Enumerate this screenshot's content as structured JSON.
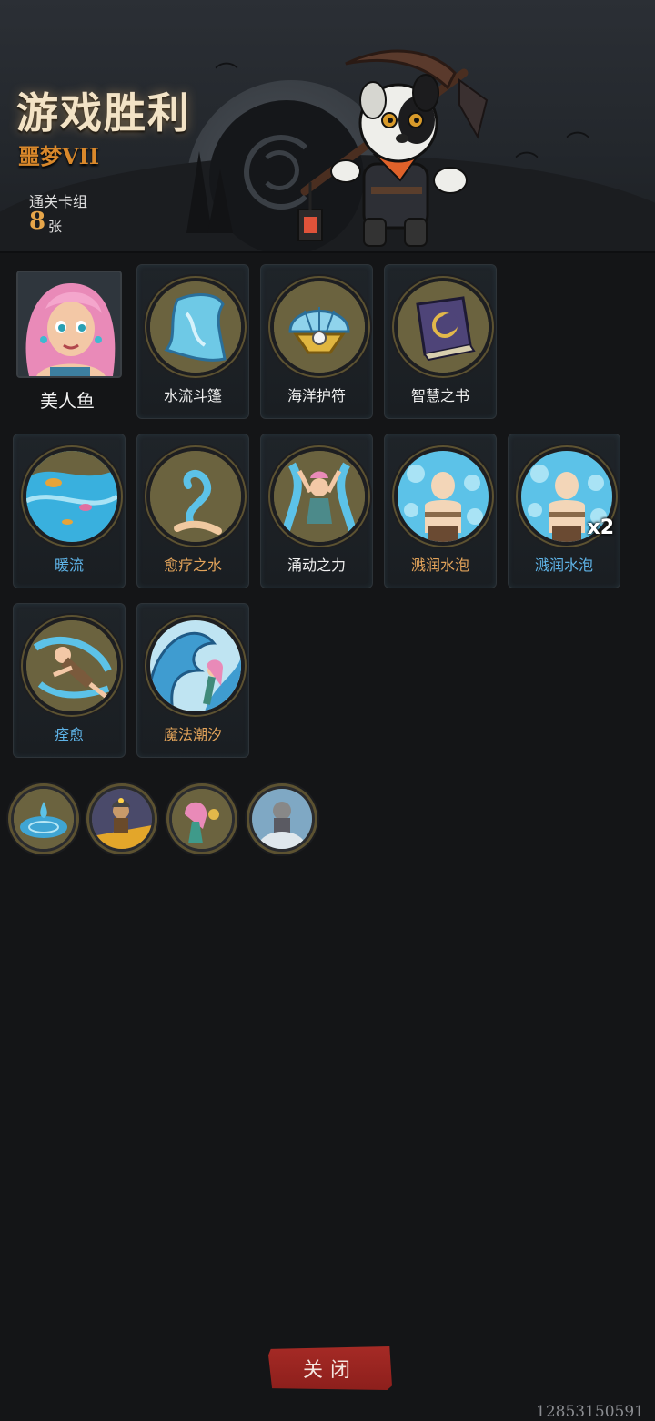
{
  "header": {
    "title": "游戏胜利",
    "difficulty": "噩梦VII",
    "deck_label": "通关卡组",
    "deck_count": "8",
    "deck_unit": "张"
  },
  "character": {
    "name": "美人鱼",
    "portrait_icon": "mermaid-portrait"
  },
  "cards_row1": [
    {
      "name": "水流斗篷",
      "icon": "water-cloak-icon",
      "color": "white"
    },
    {
      "name": "海洋护符",
      "icon": "ocean-amulet-icon",
      "color": "white"
    },
    {
      "name": "智慧之书",
      "icon": "book-of-wisdom-icon",
      "color": "white"
    }
  ],
  "cards_row2": [
    {
      "name": "暖流",
      "icon": "warm-current-icon",
      "color": "blue"
    },
    {
      "name": "愈疗之水",
      "icon": "healing-water-icon",
      "color": "orange"
    },
    {
      "name": "涌动之力",
      "icon": "surging-power-icon",
      "color": "white"
    },
    {
      "name": "溅润水泡",
      "icon": "water-bubble-icon",
      "color": "orange"
    },
    {
      "name": "溅润水泡",
      "icon": "water-bubble-icon",
      "color": "blue",
      "multiplier": "x2"
    }
  ],
  "cards_row3": [
    {
      "name": "痊愈",
      "icon": "recovery-icon",
      "color": "blue"
    },
    {
      "name": "魔法潮汐",
      "icon": "magic-tide-icon",
      "color": "orange"
    }
  ],
  "relics": [
    {
      "icon": "water-drop-relic-icon"
    },
    {
      "icon": "miner-relic-icon"
    },
    {
      "icon": "mermaid-relic-icon"
    },
    {
      "icon": "knight-relic-icon"
    }
  ],
  "footer": {
    "close_label": "关闭",
    "id_text": "12853150591"
  },
  "colors": {
    "background": "#141517",
    "title": "#f3e3c6",
    "difficulty": "#d9882b",
    "blue_name": "#5fb4e8",
    "orange_name": "#e2a35a",
    "close_button": "#a52a25"
  }
}
